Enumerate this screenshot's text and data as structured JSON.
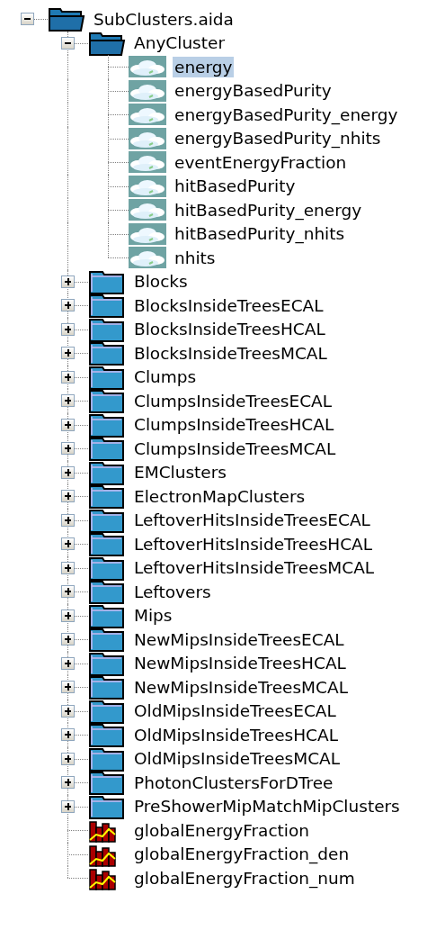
{
  "tree": {
    "label": "SubClusters.aida",
    "kind": "folder",
    "expanded": true,
    "selected": false,
    "children": [
      {
        "label": "AnyCluster",
        "kind": "folder",
        "expanded": true,
        "selected": false,
        "children": [
          {
            "label": "energy",
            "kind": "cloud",
            "selected": true
          },
          {
            "label": "energyBasedPurity",
            "kind": "cloud",
            "selected": false
          },
          {
            "label": "energyBasedPurity_energy",
            "kind": "cloud",
            "selected": false
          },
          {
            "label": "energyBasedPurity_nhits",
            "kind": "cloud",
            "selected": false
          },
          {
            "label": "eventEnergyFraction",
            "kind": "cloud",
            "selected": false
          },
          {
            "label": "hitBasedPurity",
            "kind": "cloud",
            "selected": false
          },
          {
            "label": "hitBasedPurity_energy",
            "kind": "cloud",
            "selected": false
          },
          {
            "label": "hitBasedPurity_nhits",
            "kind": "cloud",
            "selected": false
          },
          {
            "label": "nhits",
            "kind": "cloud",
            "selected": false
          }
        ]
      },
      {
        "label": "Blocks",
        "kind": "folder",
        "expanded": false,
        "selected": false
      },
      {
        "label": "BlocksInsideTreesECAL",
        "kind": "folder",
        "expanded": false,
        "selected": false
      },
      {
        "label": "BlocksInsideTreesHCAL",
        "kind": "folder",
        "expanded": false,
        "selected": false
      },
      {
        "label": "BlocksInsideTreesMCAL",
        "kind": "folder",
        "expanded": false,
        "selected": false
      },
      {
        "label": "Clumps",
        "kind": "folder",
        "expanded": false,
        "selected": false
      },
      {
        "label": "ClumpsInsideTreesECAL",
        "kind": "folder",
        "expanded": false,
        "selected": false
      },
      {
        "label": "ClumpsInsideTreesHCAL",
        "kind": "folder",
        "expanded": false,
        "selected": false
      },
      {
        "label": "ClumpsInsideTreesMCAL",
        "kind": "folder",
        "expanded": false,
        "selected": false
      },
      {
        "label": "EMClusters",
        "kind": "folder",
        "expanded": false,
        "selected": false
      },
      {
        "label": "ElectronMapClusters",
        "kind": "folder",
        "expanded": false,
        "selected": false
      },
      {
        "label": "LeftoverHitsInsideTreesECAL",
        "kind": "folder",
        "expanded": false,
        "selected": false
      },
      {
        "label": "LeftoverHitsInsideTreesHCAL",
        "kind": "folder",
        "expanded": false,
        "selected": false
      },
      {
        "label": "LeftoverHitsInsideTreesMCAL",
        "kind": "folder",
        "expanded": false,
        "selected": false
      },
      {
        "label": "Leftovers",
        "kind": "folder",
        "expanded": false,
        "selected": false
      },
      {
        "label": "Mips",
        "kind": "folder",
        "expanded": false,
        "selected": false
      },
      {
        "label": "NewMipsInsideTreesECAL",
        "kind": "folder",
        "expanded": false,
        "selected": false
      },
      {
        "label": "NewMipsInsideTreesHCAL",
        "kind": "folder",
        "expanded": false,
        "selected": false
      },
      {
        "label": "NewMipsInsideTreesMCAL",
        "kind": "folder",
        "expanded": false,
        "selected": false
      },
      {
        "label": "OldMipsInsideTreesECAL",
        "kind": "folder",
        "expanded": false,
        "selected": false
      },
      {
        "label": "OldMipsInsideTreesHCAL",
        "kind": "folder",
        "expanded": false,
        "selected": false
      },
      {
        "label": "OldMipsInsideTreesMCAL",
        "kind": "folder",
        "expanded": false,
        "selected": false
      },
      {
        "label": "PhotonClustersForDTree",
        "kind": "folder",
        "expanded": false,
        "selected": false
      },
      {
        "label": "PreShowerMipMatchMipClusters",
        "kind": "folder",
        "expanded": false,
        "selected": false
      },
      {
        "label": "globalEnergyFraction",
        "kind": "plot",
        "selected": false
      },
      {
        "label": "globalEnergyFraction_den",
        "kind": "plot",
        "selected": false
      },
      {
        "label": "globalEnergyFraction_num",
        "kind": "plot",
        "selected": false
      }
    ]
  }
}
